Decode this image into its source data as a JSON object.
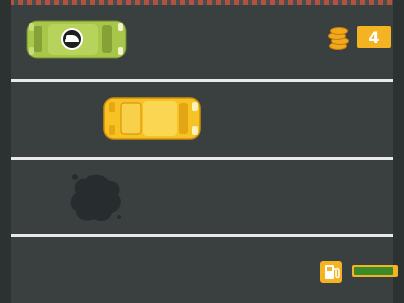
{
  "hud": {
    "coin_count": "4",
    "fuel_level": 0.92
  },
  "icons": {
    "coins": "coin-stack-icon",
    "fuel": "fuel-pump-icon",
    "player": "helmet-icon"
  },
  "colors": {
    "road": "#3a3f40",
    "lane_line": "#e9e9e9",
    "hud_accent": "#f4b323",
    "player_car": "#a7c64a",
    "enemy_car": "#f7c223",
    "fuel_fill": "#3b8a2a",
    "oil_spill": "#272c2e"
  }
}
